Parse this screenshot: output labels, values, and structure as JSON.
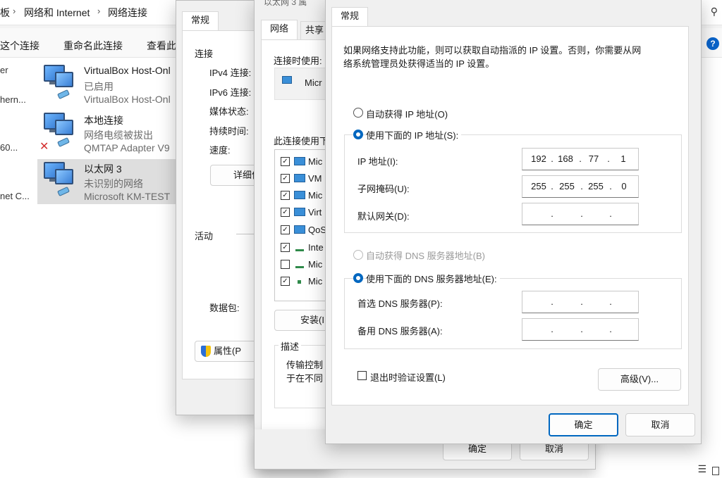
{
  "breadcrumb": {
    "part1": "板",
    "part2": "网络和 Internet",
    "part3": "网络连接"
  },
  "toolbar": {
    "cmd1": "这个连接",
    "cmd2": "重命名此连接",
    "cmd3": "查看此",
    "help": "?"
  },
  "left_cut": {
    "r1a": "er",
    "r1b": "hern...",
    "r2": "60...",
    "r3": "net C..."
  },
  "adapters": [
    {
      "name": "VirtualBox Host-Onl",
      "status": "已启用",
      "device": "VirtualBox Host-Onl"
    },
    {
      "name": "本地连接",
      "status": "网络电缆被拔出",
      "device": "QMTAP Adapter V9"
    },
    {
      "name": "以太网 3",
      "status": "未识别的网络",
      "device": "Microsoft KM-TEST"
    }
  ],
  "status_dialog": {
    "tab": "常规",
    "section_conn": "连接",
    "ipv4": "IPv4 连接:",
    "ipv6": "IPv6 连接:",
    "media": "媒体状态:",
    "duration": "持续时间:",
    "speed": "速度:",
    "details_btn": "详细信",
    "section_activity": "活动",
    "packets": "数据包:",
    "props_btn": "属性(P"
  },
  "props_dialog": {
    "title": "以太网 3 属",
    "tab_network": "网络",
    "tab_share": "共享",
    "connect_using": "连接时使用:",
    "adapter": "Micr",
    "uses_items": "此连接使用下",
    "items": [
      {
        "label": "Mic",
        "checked": true
      },
      {
        "label": "VM",
        "checked": true
      },
      {
        "label": "Mic",
        "checked": true
      },
      {
        "label": "Virt",
        "checked": true
      },
      {
        "label": "QoS",
        "checked": true
      },
      {
        "label": "Inte",
        "checked": true
      },
      {
        "label": "Mic",
        "checked": false
      },
      {
        "label": "Mic",
        "checked": true
      }
    ],
    "install_btn": "安装(I",
    "desc_title": "描述",
    "desc_line1": "传输控制",
    "desc_line2": "于在不同",
    "ok": "确定",
    "cancel": "取消"
  },
  "ipv4_dialog": {
    "tab": "常规",
    "intro_line1": "如果网络支持此功能，则可以获取自动指派的 IP 设置。否则，你需要从网",
    "intro_line2": "络系统管理员处获得适当的 IP 设置。",
    "auto_ip": "自动获得 IP 地址(O)",
    "manual_ip": "使用下面的 IP 地址(S):",
    "ip_label": "IP 地址(I):",
    "ip": [
      "192",
      "168",
      "77",
      "1"
    ],
    "mask_label": "子网掩码(U):",
    "mask": [
      "255",
      "255",
      "255",
      "0"
    ],
    "gateway_label": "默认网关(D):",
    "auto_dns": "自动获得 DNS 服务器地址(B)",
    "manual_dns": "使用下面的 DNS 服务器地址(E):",
    "dns1_label": "首选 DNS 服务器(P):",
    "dns2_label": "备用 DNS 服务器(A):",
    "validate": "退出时验证设置(L)",
    "advanced": "高级(V)...",
    "ok": "确定",
    "cancel": "取消"
  }
}
